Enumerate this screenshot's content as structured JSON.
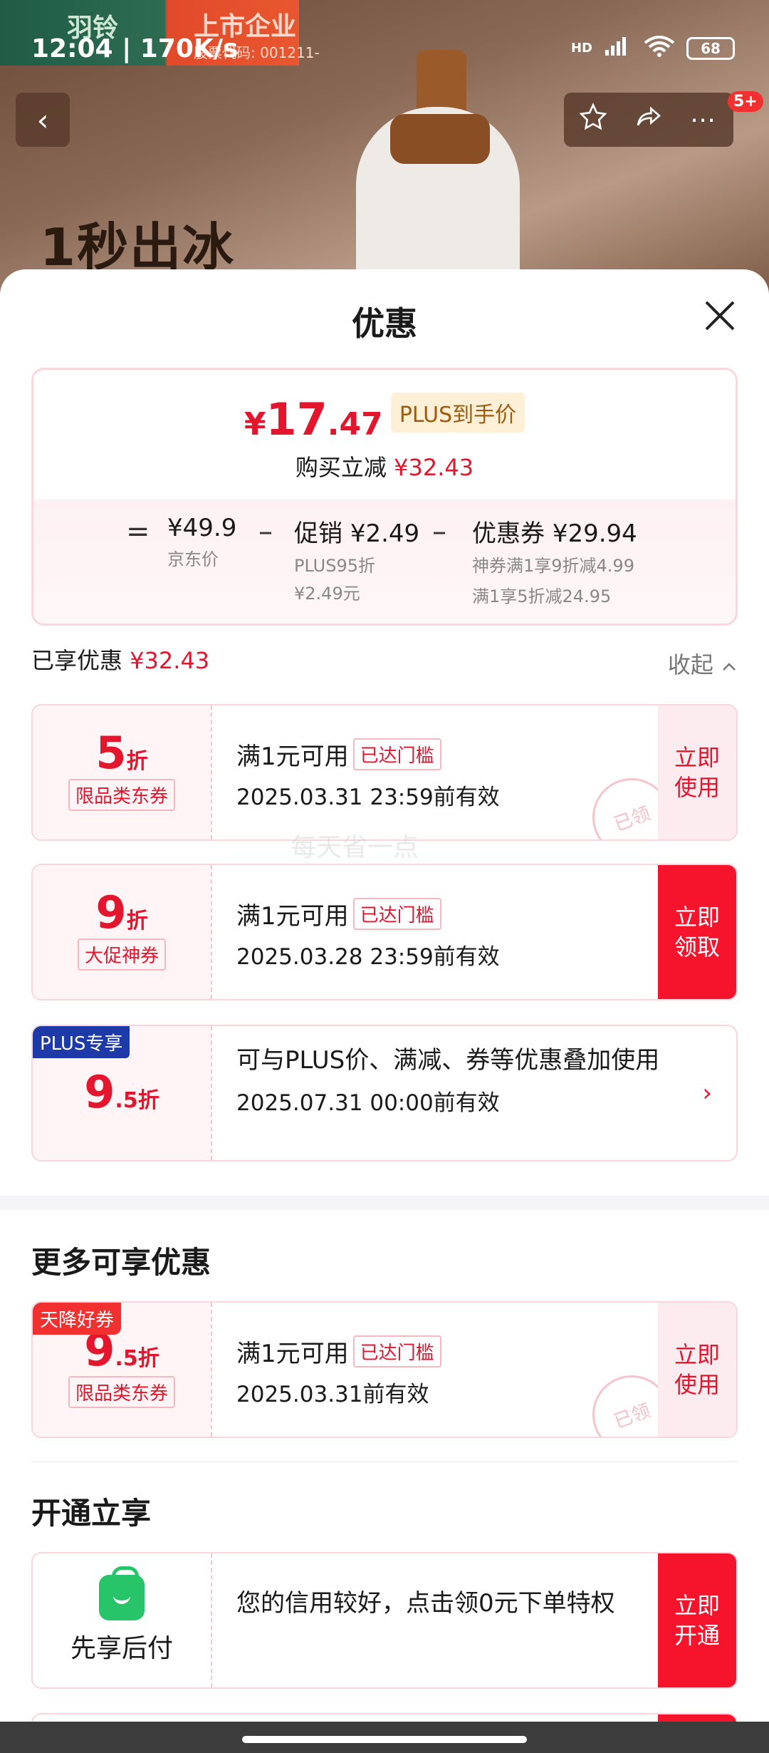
{
  "status_bar": {
    "time": "12:04 | 170K/s",
    "network": "HD",
    "battery": "68"
  },
  "background": {
    "logo": "羽铃",
    "badge_text": "上市企业",
    "code_text": "股票代码: 001211-",
    "headline": "1秒出冰"
  },
  "nav": {
    "back_icon": "‹",
    "more_badge": "5+"
  },
  "sheet": {
    "title": "优惠",
    "summary": {
      "price_symbol": "¥",
      "price_int": "17",
      "price_dec": ".47",
      "plus_tag": "PLUS到手价",
      "reduce_label": "购买立减",
      "reduce_value": "¥32.43",
      "jd_price": "¥49.9",
      "jd_label": "京东价",
      "promo_label": "促销",
      "promo_value": "¥2.49",
      "promo_sub1": "PLUS95折",
      "promo_sub2": "¥2.49元",
      "coupon_label": "优惠券",
      "coupon_value": "¥29.94",
      "coupon_sub1": "神券满1享9折减4.99",
      "coupon_sub2": "满1享5折减24.95"
    },
    "enjoyed_label": "已享优惠",
    "enjoyed_value": "¥32.43",
    "collapse_label": "收起",
    "coupons": [
      {
        "value": "5",
        "unit": "折",
        "tag": "限品类东券",
        "cond": "满1元可用",
        "status": "已达门槛",
        "date": "2025.03.31 23:59前有效",
        "action": "立即使用",
        "stamp": "已领"
      },
      {
        "value": "9",
        "unit": "折",
        "tag": "大促神券",
        "cond": "满1元可用",
        "status": "已达门槛",
        "date": "2025.03.28 23:59前有效",
        "action": "立即领取"
      },
      {
        "flag": "PLUS专享",
        "value": "9",
        "dec": ".5",
        "unit": "折",
        "desc": "可与PLUS价、满减、券等优惠叠加使用",
        "date": "2025.07.31 00:00前有效"
      }
    ],
    "more_title": "更多可享优惠",
    "more_coupon": {
      "flag": "天降好券",
      "value": "9",
      "dec": ".5",
      "unit": "折",
      "tag": "限品类东券",
      "cond": "满1元可用",
      "status": "已达门槛",
      "date": "2025.03.31前有效",
      "action": "立即使用",
      "stamp": "已领"
    },
    "open_title": "开通立享",
    "open_card": {
      "name": "先享后付",
      "desc": "您的信用较好，点击领0元下单特权",
      "action": "立即开通"
    },
    "watermark": "每天省一点"
  },
  "colors": {
    "accent": "#e3162d",
    "action_red": "#f5142c",
    "plus_blue": "#1d3aa8"
  }
}
